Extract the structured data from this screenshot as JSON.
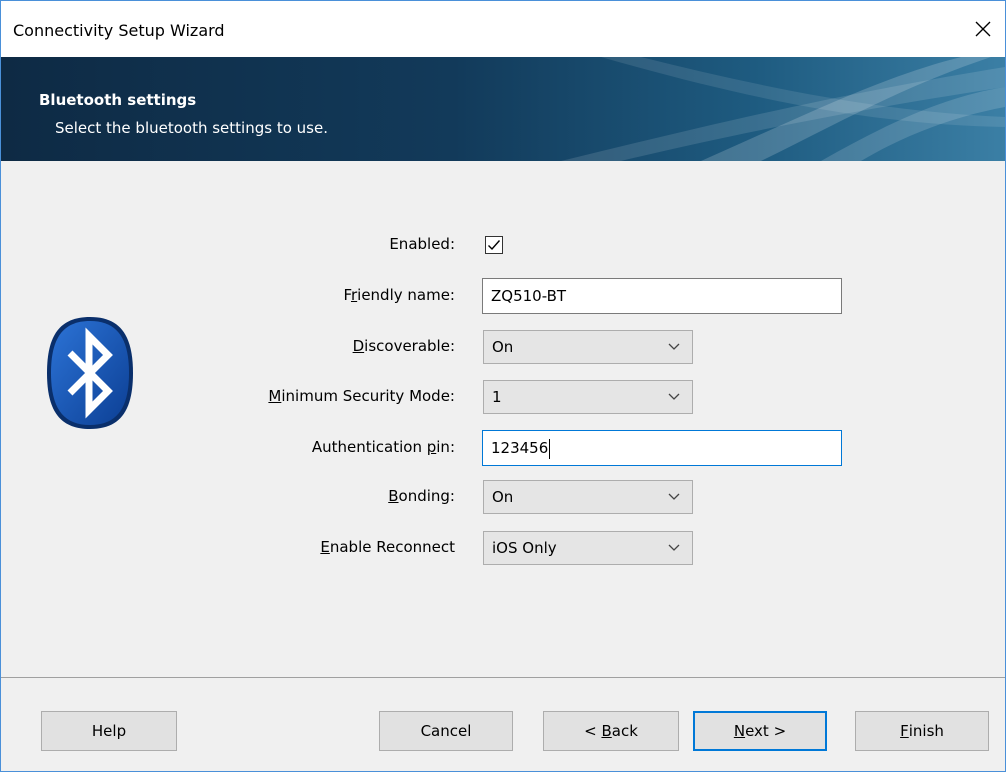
{
  "window": {
    "title": "Connectivity Setup Wizard"
  },
  "banner": {
    "title": "Bluetooth settings",
    "subtitle": "Select the bluetooth settings to use."
  },
  "icons": {
    "logo": "bluetooth-logo-icon",
    "close": "close-icon",
    "check": "checkmark-icon",
    "dropdown": "chevron-down-icon"
  },
  "form": {
    "enabled": {
      "label": "Enabled:",
      "checked": true
    },
    "friendly_name": {
      "label_pre": "F",
      "label_ul": "r",
      "label_post": "iendly name:",
      "value": "ZQ510-BT"
    },
    "discoverable": {
      "label_pre": "",
      "label_ul": "D",
      "label_post": "iscoverable:",
      "value": "On"
    },
    "min_security": {
      "label_pre": "",
      "label_ul": "M",
      "label_post": "inimum Security Mode:",
      "value": "1"
    },
    "auth_pin": {
      "label_pre": "Authentication ",
      "label_ul": "p",
      "label_post": "in:",
      "value": "123456"
    },
    "bonding": {
      "label_pre": "",
      "label_ul": "B",
      "label_post": "onding:",
      "value": "On"
    },
    "reconnect": {
      "label_pre": "",
      "label_ul": "E",
      "label_post": "nable Reconnect",
      "value": "iOS Only"
    }
  },
  "buttons": {
    "help": {
      "label": "Help"
    },
    "cancel": {
      "label": "Cancel"
    },
    "back": {
      "label_pre": "< ",
      "label_ul": "B",
      "label_post": "ack"
    },
    "next": {
      "label_pre": "",
      "label_ul": "N",
      "label_post": "ext >"
    },
    "finish": {
      "label_pre": "",
      "label_ul": "F",
      "label_post": "inish"
    }
  },
  "colors": {
    "accent": "#0078d7",
    "banner_dark": "#0e2a44",
    "bluetooth_blue": "#1556b8"
  }
}
